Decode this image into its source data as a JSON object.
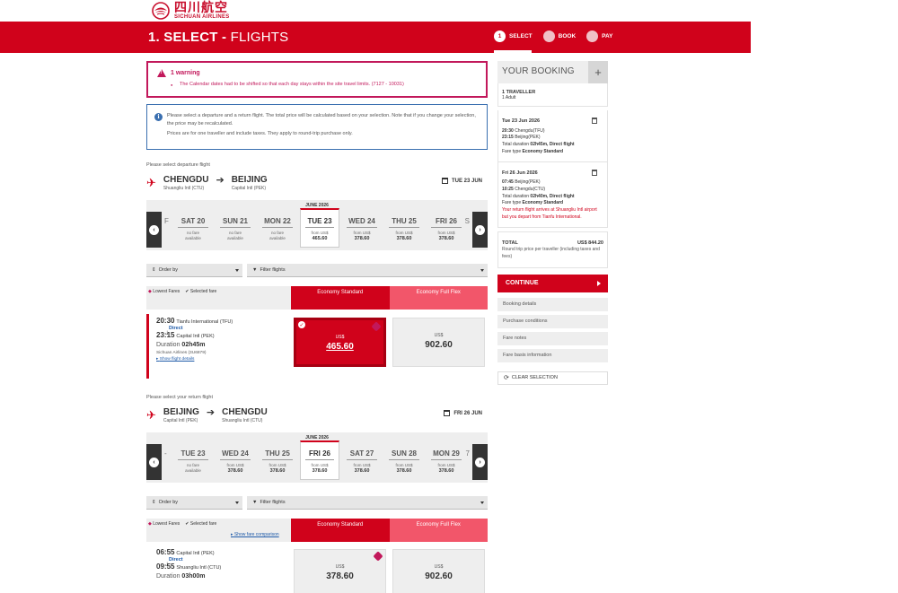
{
  "brand": {
    "logo_cn": "四川航空",
    "logo_en": "SICHUAN AIRLINES"
  },
  "banner": {
    "title_strong": "1. SELECT -",
    "title_rest": " FLIGHTS",
    "steps": [
      {
        "num": "1",
        "label": "SELECT"
      },
      {
        "num": "",
        "label": "BOOK"
      },
      {
        "num": "",
        "label": "PAY"
      }
    ]
  },
  "warning": {
    "title": "1 warning",
    "message": "The Calendar dates had to be shifted so that each day stays within the site travel limits. (7127 - 10031)"
  },
  "info": {
    "line1": "Please select a departure and a return flight. The total price will be calculated based on your selection. Note that if you change your selection, the price may be recalculated.",
    "line2": "Prices are for one traveller and include taxes. They apply to round-trip purchase only."
  },
  "outbound": {
    "section_label": "Please select departure flight",
    "from_city": "CHENGDU",
    "from_airport": "Shuangliu Intl (CTU)",
    "to_city": "BEIJING",
    "to_airport": "Capital Intl (PEK)",
    "date": "TUE 23 JUN",
    "month": "JUNE 2026",
    "left_frag": "F",
    "right_frag": "S",
    "days": [
      {
        "name": "SAT 20",
        "line1": "no fare",
        "line2": "available",
        "price": ""
      },
      {
        "name": "SUN 21",
        "line1": "no fare",
        "line2": "available",
        "price": ""
      },
      {
        "name": "MON 22",
        "line1": "no fare",
        "line2": "available",
        "price": ""
      },
      {
        "name": "TUE 23",
        "line1": "from US$",
        "line2": "",
        "price": "465.60",
        "selected": true
      },
      {
        "name": "WED 24",
        "line1": "from US$",
        "line2": "",
        "price": "378.60"
      },
      {
        "name": "THU 25",
        "line1": "from US$",
        "line2": "",
        "price": "378.60"
      },
      {
        "name": "FRI 26",
        "line1": "from US$",
        "line2": "",
        "price": "378.60"
      }
    ],
    "order_by": "Order by",
    "filter": "Filter flights",
    "legend_lowest": "Lowest Fares",
    "legend_selected": "Selected fare",
    "fare_std": "Economy Standard",
    "fare_flex": "Economy Full Flex",
    "flight": {
      "dep_time": "20:30",
      "dep_ap": "Tianfu International (TFU)",
      "direct": "Direct",
      "arr_time": "23:15",
      "arr_ap": "Capital Intl (PEK)",
      "duration_label": "Duration",
      "duration": "02h45m",
      "airline": "Sichuan Airlines (3U6879)",
      "details": "Show flight details",
      "std_cur": "US$",
      "std_price": "465.60",
      "flex_cur": "US$",
      "flex_price": "902.60"
    }
  },
  "inbound": {
    "section_label": "Please select your return flight",
    "from_city": "BEIJING",
    "from_airport": "Capital Intl (PEK)",
    "to_city": "CHENGDU",
    "to_airport": "Shuangliu Intl (CTU)",
    "date": "FRI 26 JUN",
    "month": "JUNE 2026",
    "left_frag": "-",
    "right_frag": "7",
    "days": [
      {
        "name": "TUE 23",
        "line1": "no fare",
        "line2": "available",
        "price": ""
      },
      {
        "name": "WED 24",
        "line1": "from US$",
        "line2": "",
        "price": "378.60"
      },
      {
        "name": "THU 25",
        "line1": "from US$",
        "line2": "",
        "price": "378.60"
      },
      {
        "name": "FRI 26",
        "line1": "from US$",
        "line2": "",
        "price": "378.60",
        "selected": true
      },
      {
        "name": "SAT 27",
        "line1": "from US$",
        "line2": "",
        "price": "378.60"
      },
      {
        "name": "SUN 28",
        "line1": "from US$",
        "line2": "",
        "price": "378.60"
      },
      {
        "name": "MON 29",
        "line1": "from US$",
        "line2": "",
        "price": "378.60"
      }
    ],
    "order_by": "Order by",
    "filter": "Filter flights",
    "legend_lowest": "Lowest Fares",
    "legend_selected": "Selected fare",
    "fare_comparison": "Show fare comparison",
    "fare_std": "Economy Standard",
    "fare_flex": "Economy Full Flex",
    "flight": {
      "dep_time": "06:55",
      "dep_ap": "Capital Intl (PEK)",
      "direct": "Direct",
      "arr_time": "09:55",
      "arr_ap": "Shuangliu Intl (CTU)",
      "duration_label": "Duration",
      "duration": "03h00m",
      "std_cur": "US$",
      "std_price": "378.60",
      "flex_cur": "US$",
      "flex_price": "902.60"
    }
  },
  "booking": {
    "title": "YOUR BOOKING",
    "plus": "+",
    "travellers": "1 TRAVELLER",
    "travellers_sub": "1 Adult",
    "seg1": {
      "date": "Tue 23 Jun 2026",
      "dep_time": "20:30",
      "dep": "Chengdu(TFU)",
      "arr_time": "23:15",
      "arr": "Beijing(PEK)",
      "duration_label": "Total duration",
      "duration": "02h45m, Direct flight",
      "fare_label": "Fare type",
      "fare": "Economy Standard"
    },
    "seg2": {
      "date": "Fri 26 Jun 2026",
      "dep_time": "07:45",
      "dep": "Beijing(PEK)",
      "arr_time": "10:25",
      "arr": "Chengdu(CTU)",
      "duration_label": "Total duration",
      "duration": "02h40m, Direct flight",
      "fare_label": "Fare type",
      "fare": "Economy Standard",
      "warning": "Your return flight arrives at Shuangliu Intl airport but you depart from Tianfu International."
    },
    "total_label": "TOTAL",
    "total_value": "US$ 844.20",
    "total_note": "Round trip price per traveller (including taxes and fees)",
    "continue": "CONTINUE",
    "links": [
      "Booking details",
      "Purchase conditions",
      "Fare notes",
      "Fare basis information"
    ],
    "clear": "CLEAR SELECTION"
  }
}
